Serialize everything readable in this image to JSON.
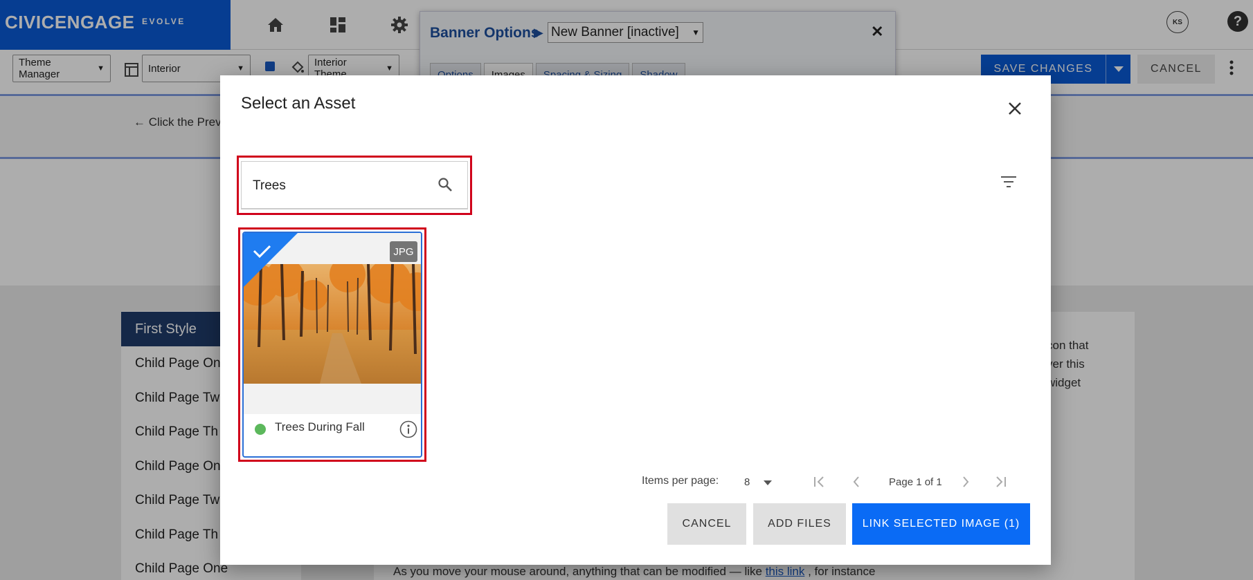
{
  "app": {
    "brand": "CIVICENGAGE",
    "brand_sub": "EVOLVE",
    "avatar_initials": "KS",
    "help_glyph": "?"
  },
  "toolbar": {
    "theme_manager": "Theme Manager",
    "layout": "Interior",
    "theme": "Interior Theme",
    "save_label": "SAVE CHANGES",
    "cancel_label": "CANCEL"
  },
  "banner_options": {
    "title": "Banner Options",
    "selected_banner": "New Banner [inactive]",
    "tabs": [
      "Options",
      "Images",
      "Spacing & Sizing",
      "Shadow"
    ]
  },
  "page_background": {
    "hint": "← Click the Prev",
    "nav_first": "First Style",
    "nav_items": [
      "Child Page On",
      "Child Page Tw",
      "Child Page Th",
      "Child Page On",
      "Child Page Tw",
      "Child Page Th",
      "Child Page One"
    ],
    "right_lines": [
      "con that",
      "ver this",
      "widget"
    ],
    "bottom_text_before": "As you move your mouse around, anything that can be modified — like ",
    "bottom_link": "this link",
    "bottom_text_after": " , for instance"
  },
  "modal": {
    "title": "Select an Asset",
    "search": {
      "value": "Trees"
    },
    "assets": [
      {
        "name": "Trees During Fall",
        "type": "JPG",
        "selected": true,
        "status_color": "#5cb85c"
      }
    ],
    "items_per_page_label": "Items per page:",
    "items_per_page": "8",
    "page_label": "Page 1 of 1",
    "cancel_label": "CANCEL",
    "add_files_label": "ADD FILES",
    "link_label": "LINK SELECTED IMAGE (1)"
  },
  "colors": {
    "brand_blue": "#0a5bd6",
    "primary_button": "#0a6bf5",
    "highlight_red": "#d0021b",
    "status_green": "#5cb85c"
  },
  "icons": [
    "home-icon",
    "dashboard-icon",
    "gear-icon",
    "search-icon",
    "filter-icon",
    "check-icon",
    "info-icon",
    "close-icon",
    "first-page-icon",
    "prev-page-icon",
    "next-page-icon",
    "last-page-icon"
  ]
}
